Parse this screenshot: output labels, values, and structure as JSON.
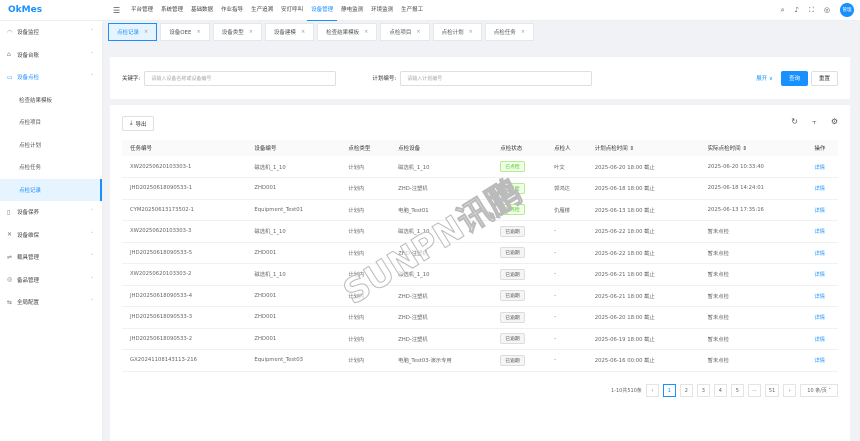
{
  "app": {
    "logo": "OkMes",
    "watermark": "SUNPN讯鹏",
    "avatar": "管理"
  },
  "topnav": [
    "平台管理",
    "系统管理",
    "基础数据",
    "作业指导",
    "生产追溯",
    "安灯呼叫",
    "设备管理",
    "静电监测",
    "环境监测",
    "生产报工"
  ],
  "topnav_active": 6,
  "sidebar": [
    {
      "label": "设备监控",
      "icon": "monitor-icon",
      "chev": "˅"
    },
    {
      "label": "设备台账",
      "icon": "ledger-icon",
      "chev": "˅"
    },
    {
      "label": "设备点检",
      "icon": "inspect-icon",
      "chev": "˄",
      "open": true
    },
    {
      "label": "检查结果模板",
      "sub": true
    },
    {
      "label": "点检项目",
      "sub": true
    },
    {
      "label": "点检计划",
      "sub": true
    },
    {
      "label": "点检任务",
      "sub": true
    },
    {
      "label": "点检记录",
      "sub": true,
      "active": true
    },
    {
      "label": "设备保养",
      "icon": "file-icon",
      "chev": "˅"
    },
    {
      "label": "设备维保",
      "icon": "tool-icon",
      "chev": "˅"
    },
    {
      "label": "载具管理",
      "icon": "carrier-icon",
      "chev": "˅"
    },
    {
      "label": "备品管理",
      "icon": "spare-icon",
      "chev": "˅"
    },
    {
      "label": "全局配置",
      "icon": "settings-icon",
      "chev": "˅"
    }
  ],
  "tabs": [
    "点检记录",
    "设备OEE",
    "设备类型",
    "设备建模",
    "检查结果模板",
    "点检项目",
    "点检计划",
    "点检任务"
  ],
  "search": {
    "keyword_label": "关键字:",
    "keyword_placeholder": "请输入设备名称或设备编号",
    "plan_label": "计划编号:",
    "plan_placeholder": "请输入计划编号",
    "expand": "展开 ∨",
    "query": "查询",
    "reset": "重置"
  },
  "toolbar": {
    "export": "导出"
  },
  "columns": [
    "任务编号",
    "设备编号",
    "点检类型",
    "点检设备",
    "点检状态",
    "点检人",
    "计划点检时间 ⇕",
    "实际点检时间 ⇕",
    "操作"
  ],
  "rows": [
    [
      "XW20250620103303-1",
      "磁选机_1_10",
      "计划内",
      "磁选机_1_10",
      "已点检",
      "叶文",
      "2025-06-20 18:00 截止",
      "2025-06-20 10:33:40",
      "详情"
    ],
    [
      "JHD20250618090533-1",
      "ZHD001",
      "计划内",
      "ZHD-注塑机",
      "已点检",
      "郭鸿达",
      "2025-06-18 18:00 截止",
      "2025-06-18 14:24:01",
      "详情"
    ],
    [
      "CYM20250613173502-1",
      "Equipment_Test01",
      "计划内",
      "电脑_Test01",
      "已点检",
      "仇雁楼",
      "2025-06-13 18:00 截止",
      "2025-06-13 17:35:16",
      "详情"
    ],
    [
      "XW20250620103303-3",
      "磁选机_1_10",
      "计划内",
      "磁选机_1_10",
      "已逾期",
      "-",
      "2025-06-22 18:00 截止",
      "暂未点检",
      "详情"
    ],
    [
      "JHD20250618090533-5",
      "ZHD001",
      "计划内",
      "ZHD-注塑机",
      "已逾期",
      "-",
      "2025-06-22 18:00 截止",
      "暂未点检",
      "详情"
    ],
    [
      "XW20250620103303-2",
      "磁选机_1_10",
      "计划内",
      "磁选机_1_10",
      "已逾期",
      "-",
      "2025-06-21 18:00 截止",
      "暂未点检",
      "详情"
    ],
    [
      "JHD20250618090533-4",
      "ZHD001",
      "计划内",
      "ZHD-注塑机",
      "已逾期",
      "-",
      "2025-06-21 18:00 截止",
      "暂未点检",
      "详情"
    ],
    [
      "JHD20250618090533-3",
      "ZHD001",
      "计划内",
      "ZHD-注塑机",
      "已逾期",
      "-",
      "2025-06-20 18:00 截止",
      "暂未点检",
      "详情"
    ],
    [
      "JHD20250618090533-2",
      "ZHD001",
      "计划内",
      "ZHD-注塑机",
      "已逾期",
      "-",
      "2025-06-19 18:00 截止",
      "暂未点检",
      "详情"
    ],
    [
      "GX20241108143113-216",
      "Equipment_Test03",
      "计划内",
      "电脑_Test03-演示专用",
      "已逾期",
      "-",
      "2025-06-16 00:00 截止",
      "暂未点检",
      "详情"
    ]
  ],
  "pagination": {
    "summary": "1-10共510条",
    "pages": [
      "1",
      "2",
      "3",
      "4",
      "5",
      "···",
      "51"
    ],
    "current": "1",
    "size": "10 条/页 ˅"
  },
  "colors": {
    "accent": "#1890ff",
    "done": "#52c41a"
  }
}
